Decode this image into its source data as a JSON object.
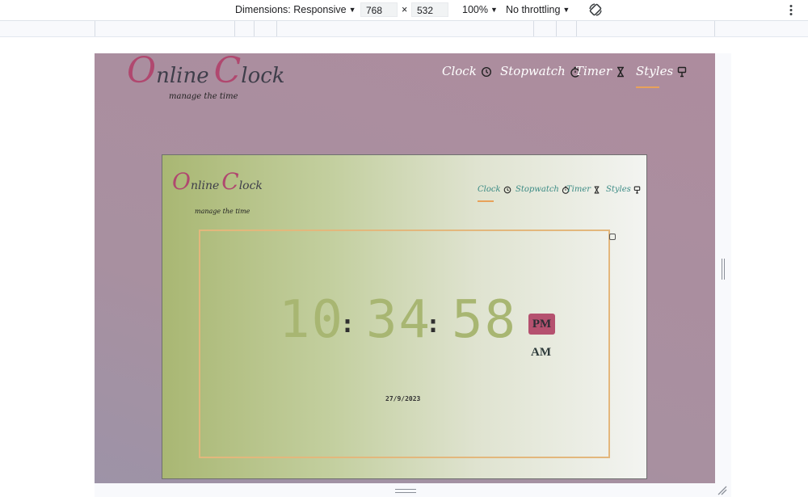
{
  "devtools": {
    "dimensions_label": "Dimensions: Responsive",
    "width_value": "768",
    "times": "×",
    "height_value": "532",
    "zoom": "100%",
    "throttle": "No throttling",
    "rotate_icon": "rotate-icon",
    "more_icon": "more-vert-icon"
  },
  "site": {
    "logo_first_initial": "O",
    "logo_first_rest": "nline",
    "logo_second_initial": "C",
    "logo_second_rest": "lock",
    "tagline": "manage the time",
    "nav": [
      {
        "label": "Clock",
        "icon": "clock-icon"
      },
      {
        "label": "Stopwatch",
        "icon": "stopwatch-icon"
      },
      {
        "label": "Timer",
        "icon": "hourglass-icon"
      },
      {
        "label": "Styles",
        "icon": "paint-roller-icon"
      }
    ],
    "active_outer": "Styles",
    "active_inner": "Clock"
  },
  "clock": {
    "hours": "10",
    "minutes": "34",
    "seconds": "58",
    "separator": ":",
    "pm_label": "PM",
    "am_label": "AM",
    "date": "27/9/2023"
  },
  "colors": {
    "accent_pink": "#b0486f",
    "digit_green": "#a8b672",
    "border_gold": "#e3b77c",
    "underline_orange": "#e8a25a"
  }
}
